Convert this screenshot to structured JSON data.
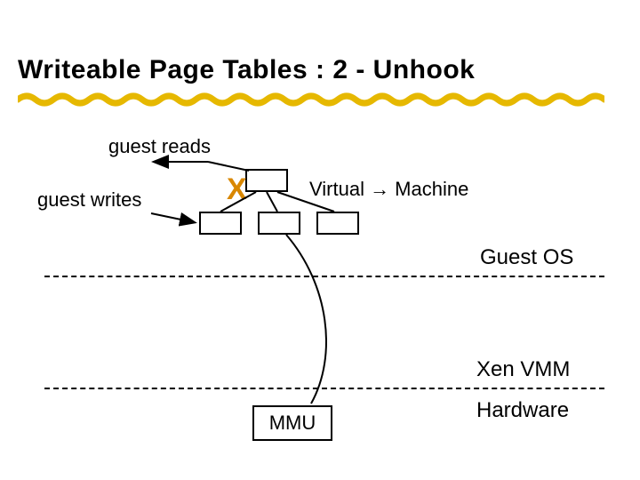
{
  "title": "Writeable Page Tables : 2 - Unhook",
  "labels": {
    "guest_reads": "guest reads",
    "guest_writes": "guest writes",
    "virtual_machine": "Virtual → Machine",
    "guest_os": "Guest OS",
    "xen_vmm": "Xen VMM",
    "hardware": "Hardware",
    "mmu": "MMU",
    "x": "X"
  },
  "colors": {
    "accent_orange": "#d98700",
    "underline_yellow": "#e6b800"
  }
}
